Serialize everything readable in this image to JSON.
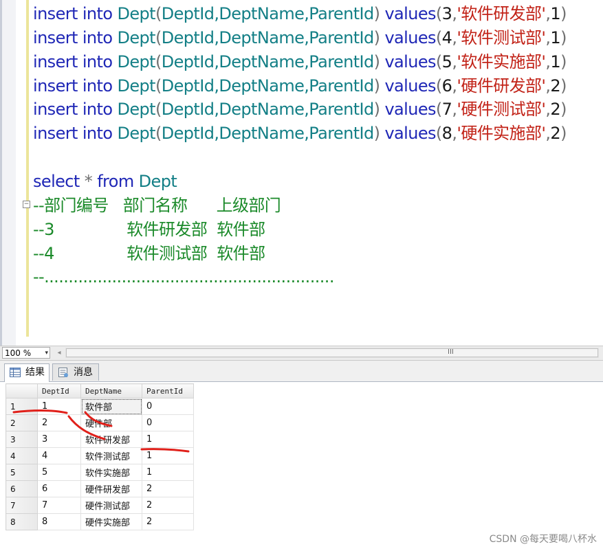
{
  "editor": {
    "insert_lines": [
      {
        "kw1": "insert",
        "kw2": "into",
        "table": "Dept",
        "p1": "(",
        "cols": "DeptId,DeptName,ParentId",
        "p2": ")",
        "kw3": "values",
        "p3": "(",
        "n1": "3",
        "c1": ",",
        "s": "'软件研发部'",
        "c2": ",",
        "n2": "1",
        "p4": ")"
      },
      {
        "kw1": "insert",
        "kw2": "into",
        "table": "Dept",
        "p1": "(",
        "cols": "DeptId,DeptName,ParentId",
        "p2": ")",
        "kw3": "values",
        "p3": "(",
        "n1": "4",
        "c1": ",",
        "s": "'软件测试部'",
        "c2": ",",
        "n2": "1",
        "p4": ")"
      },
      {
        "kw1": "insert",
        "kw2": "into",
        "table": "Dept",
        "p1": "(",
        "cols": "DeptId,DeptName,ParentId",
        "p2": ")",
        "kw3": "values",
        "p3": "(",
        "n1": "5",
        "c1": ",",
        "s": "'软件实施部'",
        "c2": ",",
        "n2": "1",
        "p4": ")"
      },
      {
        "kw1": "insert",
        "kw2": "into",
        "table": "Dept",
        "p1": "(",
        "cols": "DeptId,DeptName,ParentId",
        "p2": ")",
        "kw3": "values",
        "p3": "(",
        "n1": "6",
        "c1": ",",
        "s": "'硬件研发部'",
        "c2": ",",
        "n2": "2",
        "p4": ")"
      },
      {
        "kw1": "insert",
        "kw2": "into",
        "table": "Dept",
        "p1": "(",
        "cols": "DeptId,DeptName,ParentId",
        "p2": ")",
        "kw3": "values",
        "p3": "(",
        "n1": "7",
        "c1": ",",
        "s": "'硬件测试部'",
        "c2": ",",
        "n2": "2",
        "p4": ")"
      },
      {
        "kw1": "insert",
        "kw2": "into",
        "table": "Dept",
        "p1": "(",
        "cols": "DeptId,DeptName,ParentId",
        "p2": ")",
        "kw3": "values",
        "p3": "(",
        "n1": "8",
        "c1": ",",
        "s": "'硬件实施部'",
        "c2": ",",
        "n2": "2",
        "p4": ")"
      }
    ],
    "select_line": {
      "kw1": "select",
      "star": "*",
      "kw2": "from",
      "table": "Dept"
    },
    "comment_lines": [
      "--部门编号   部门名称      上级部门",
      "--3               软件研发部  软件部",
      "--4               软件测试部  软件部",
      "--............................................................"
    ],
    "collapse_glyph": "−"
  },
  "zoom": {
    "value": "100 %",
    "arrow": "▾"
  },
  "scrollbar": {
    "left_arrow": "◂",
    "grip": "III"
  },
  "tabs": [
    {
      "label": "结果",
      "icon": "grid-icon"
    },
    {
      "label": "消息",
      "icon": "message-icon"
    }
  ],
  "results": {
    "columns": [
      "DeptId",
      "DeptName",
      "ParentId"
    ],
    "rows": [
      {
        "n": "1",
        "id": "1",
        "name": "软件部",
        "parent": "0"
      },
      {
        "n": "2",
        "id": "2",
        "name": "硬件部",
        "parent": "0"
      },
      {
        "n": "3",
        "id": "3",
        "name": "软件研发部",
        "parent": "1"
      },
      {
        "n": "4",
        "id": "4",
        "name": "软件测试部",
        "parent": "1"
      },
      {
        "n": "5",
        "id": "5",
        "name": "软件实施部",
        "parent": "1"
      },
      {
        "n": "6",
        "id": "6",
        "name": "硬件研发部",
        "parent": "2"
      },
      {
        "n": "7",
        "id": "7",
        "name": "硬件测试部",
        "parent": "2"
      },
      {
        "n": "8",
        "id": "8",
        "name": "硬件实施部",
        "parent": "2"
      }
    ]
  },
  "watermark": "CSDN @每天要喝八杯水",
  "colors": {
    "keyword": "#1f27b6",
    "table": "#137f86",
    "string": "#c22318",
    "comment": "#1b8a2a",
    "annotation": "#e0201a"
  }
}
